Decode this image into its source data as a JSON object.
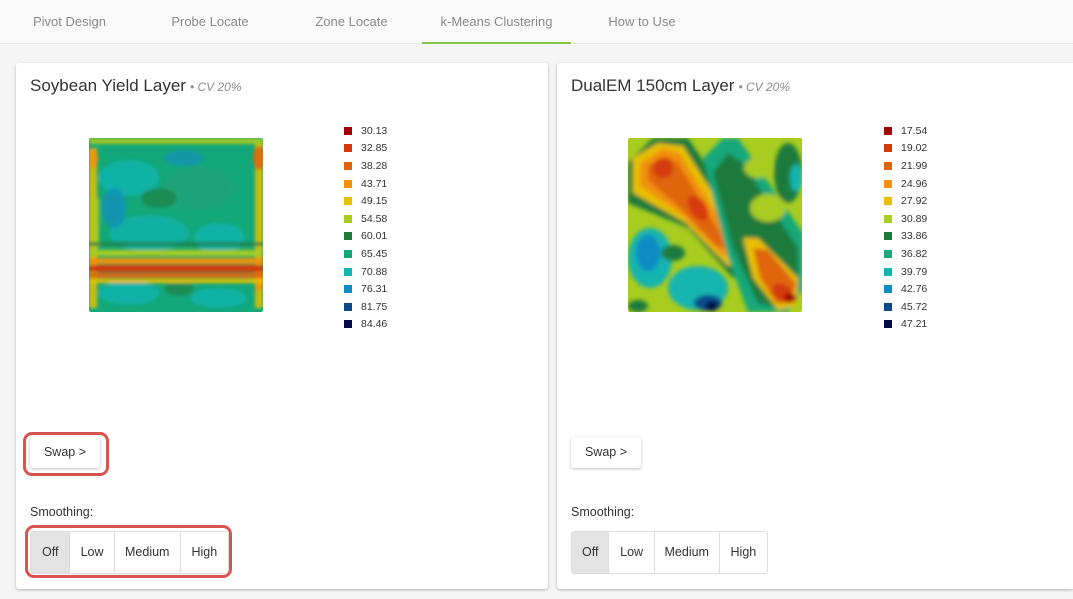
{
  "tabs": [
    {
      "label": "Pivot Design",
      "active": false
    },
    {
      "label": "Probe Locate",
      "active": false
    },
    {
      "label": "Zone Locate",
      "active": false
    },
    {
      "label": "k-Means Clustering",
      "active": true
    },
    {
      "label": "How to Use",
      "active": false
    }
  ],
  "left_card": {
    "title": "Soybean Yield Layer",
    "cv": "• CV 20%",
    "legend": [
      {
        "value": "30.13",
        "color": "#a30000"
      },
      {
        "value": "32.85",
        "color": "#d43a0a"
      },
      {
        "value": "38.28",
        "color": "#e0650a"
      },
      {
        "value": "43.71",
        "color": "#f0920a"
      },
      {
        "value": "49.15",
        "color": "#e8c000"
      },
      {
        "value": "54.58",
        "color": "#a8cc20"
      },
      {
        "value": "60.01",
        "color": "#1e7a3c"
      },
      {
        "value": "65.45",
        "color": "#13a87a"
      },
      {
        "value": "70.88",
        "color": "#14b4b0"
      },
      {
        "value": "76.31",
        "color": "#0e8cc4"
      },
      {
        "value": "81.75",
        "color": "#0a4a8a"
      },
      {
        "value": "84.46",
        "color": "#050a4a"
      }
    ],
    "swap_label": "Swap >",
    "smoothing_label": "Smoothing:",
    "smoothing_options": [
      "Off",
      "Low",
      "Medium",
      "High"
    ],
    "smoothing_selected": "Off"
  },
  "right_card": {
    "title": "DualEM 150cm Layer",
    "cv": "• CV 20%",
    "legend": [
      {
        "value": "17.54",
        "color": "#a30000"
      },
      {
        "value": "19.02",
        "color": "#d43a0a"
      },
      {
        "value": "21.99",
        "color": "#e0650a"
      },
      {
        "value": "24.96",
        "color": "#f0920a"
      },
      {
        "value": "27.92",
        "color": "#e8c000"
      },
      {
        "value": "30.89",
        "color": "#a8cc20"
      },
      {
        "value": "33.86",
        "color": "#1e7a3c"
      },
      {
        "value": "36.82",
        "color": "#13a87a"
      },
      {
        "value": "39.79",
        "color": "#14b4b0"
      },
      {
        "value": "42.76",
        "color": "#0e8cc4"
      },
      {
        "value": "45.72",
        "color": "#0a4a8a"
      },
      {
        "value": "47.21",
        "color": "#050a4a"
      }
    ],
    "swap_label": "Swap >",
    "smoothing_label": "Smoothing:",
    "smoothing_options": [
      "Off",
      "Low",
      "Medium",
      "High"
    ],
    "smoothing_selected": "Off"
  },
  "colors": {
    "accent": "#8bc34a",
    "highlight": "#d9534f"
  }
}
